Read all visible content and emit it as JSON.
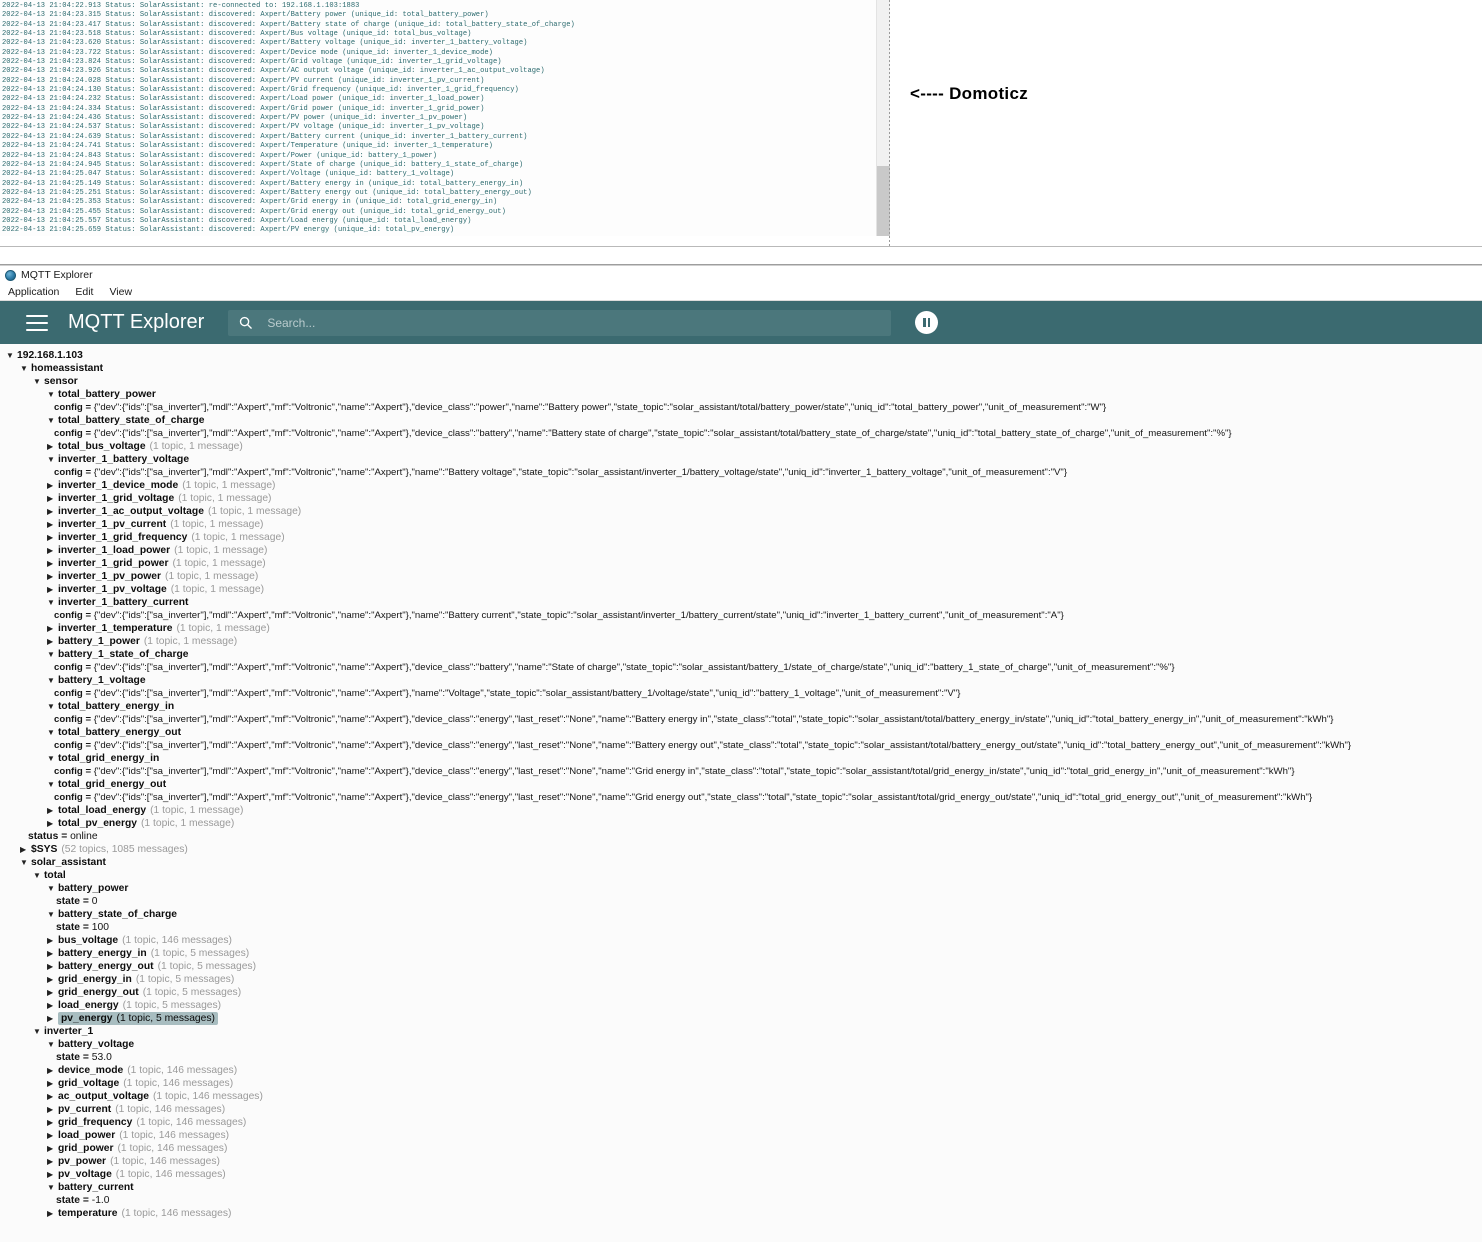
{
  "log_panel": {
    "lines": [
      "2022-04-13 21:04:22.913 Status: SolarAssistant: re-connected to: 192.168.1.103:1883",
      "2022-04-13 21:04:23.315 Status: SolarAssistant: discovered: Axpert/Battery power (unique_id: total_battery_power)",
      "2022-04-13 21:04:23.417 Status: SolarAssistant: discovered: Axpert/Battery state of charge (unique_id: total_battery_state_of_charge)",
      "2022-04-13 21:04:23.518 Status: SolarAssistant: discovered: Axpert/Bus voltage (unique_id: total_bus_voltage)",
      "2022-04-13 21:04:23.620 Status: SolarAssistant: discovered: Axpert/Battery voltage (unique_id: inverter_1_battery_voltage)",
      "2022-04-13 21:04:23.722 Status: SolarAssistant: discovered: Axpert/Device mode (unique_id: inverter_1_device_mode)",
      "2022-04-13 21:04:23.824 Status: SolarAssistant: discovered: Axpert/Grid voltage (unique_id: inverter_1_grid_voltage)",
      "2022-04-13 21:04:23.926 Status: SolarAssistant: discovered: Axpert/AC output voltage (unique_id: inverter_1_ac_output_voltage)",
      "2022-04-13 21:04:24.028 Status: SolarAssistant: discovered: Axpert/PV current (unique_id: inverter_1_pv_current)",
      "2022-04-13 21:04:24.130 Status: SolarAssistant: discovered: Axpert/Grid frequency (unique_id: inverter_1_grid_frequency)",
      "2022-04-13 21:04:24.232 Status: SolarAssistant: discovered: Axpert/Load power (unique_id: inverter_1_load_power)",
      "2022-04-13 21:04:24.334 Status: SolarAssistant: discovered: Axpert/Grid power (unique_id: inverter_1_grid_power)",
      "2022-04-13 21:04:24.436 Status: SolarAssistant: discovered: Axpert/PV power (unique_id: inverter_1_pv_power)",
      "2022-04-13 21:04:24.537 Status: SolarAssistant: discovered: Axpert/PV voltage (unique_id: inverter_1_pv_voltage)",
      "2022-04-13 21:04:24.639 Status: SolarAssistant: discovered: Axpert/Battery current (unique_id: inverter_1_battery_current)",
      "2022-04-13 21:04:24.741 Status: SolarAssistant: discovered: Axpert/Temperature (unique_id: inverter_1_temperature)",
      "2022-04-13 21:04:24.843 Status: SolarAssistant: discovered: Axpert/Power (unique_id: battery_1_power)",
      "2022-04-13 21:04:24.945 Status: SolarAssistant: discovered: Axpert/State of charge (unique_id: battery_1_state_of_charge)",
      "2022-04-13 21:04:25.047 Status: SolarAssistant: discovered: Axpert/Voltage (unique_id: battery_1_voltage)",
      "2022-04-13 21:04:25.149 Status: SolarAssistant: discovered: Axpert/Battery energy in (unique_id: total_battery_energy_in)",
      "2022-04-13 21:04:25.251 Status: SolarAssistant: discovered: Axpert/Battery energy out (unique_id: total_battery_energy_out)",
      "2022-04-13 21:04:25.353 Status: SolarAssistant: discovered: Axpert/Grid energy in (unique_id: total_grid_energy_in)",
      "2022-04-13 21:04:25.455 Status: SolarAssistant: discovered: Axpert/Grid energy out (unique_id: total_grid_energy_out)",
      "2022-04-13 21:04:25.557 Status: SolarAssistant: discovered: Axpert/Load energy (unique_id: total_load_energy)",
      "2022-04-13 21:04:25.659 Status: SolarAssistant: discovered: Axpert/PV energy (unique_id: total_pv_energy)"
    ]
  },
  "annotation": {
    "text": "<---- Domoticz"
  },
  "window": {
    "title": "MQTT Explorer",
    "menu": [
      "Application",
      "Edit",
      "View"
    ]
  },
  "app_bar": {
    "title": "MQTT Explorer",
    "search_placeholder": "Search...",
    "search_value": ""
  },
  "tree": {
    "nodes": [
      {
        "indent": 0,
        "arrow": "down",
        "label": "192.168.1.103"
      },
      {
        "indent": 1,
        "arrow": "down",
        "label": "homeassistant"
      },
      {
        "indent": 2,
        "arrow": "down",
        "label": "sensor"
      },
      {
        "indent": 3,
        "arrow": "down",
        "label": "total_battery_power"
      },
      {
        "type": "config",
        "indent": 4,
        "key": "config",
        "value": "{\"dev\":{\"ids\":[\"sa_inverter\"],\"mdl\":\"Axpert\",\"mf\":\"Voltronic\",\"name\":\"Axpert\"},\"device_class\":\"power\",\"name\":\"Battery power\",\"state_topic\":\"solar_assistant/total/battery_power/state\",\"uniq_id\":\"total_battery_power\",\"unit_of_measurement\":\"W\"}"
      },
      {
        "indent": 3,
        "arrow": "down",
        "label": "total_battery_state_of_charge"
      },
      {
        "type": "config",
        "indent": 4,
        "key": "config",
        "value": "{\"dev\":{\"ids\":[\"sa_inverter\"],\"mdl\":\"Axpert\",\"mf\":\"Voltronic\",\"name\":\"Axpert\"},\"device_class\":\"battery\",\"name\":\"Battery state of charge\",\"state_topic\":\"solar_assistant/total/battery_state_of_charge/state\",\"uniq_id\":\"total_battery_state_of_charge\",\"unit_of_measurement\":\"%\"}"
      },
      {
        "indent": 3,
        "arrow": "right",
        "label": "total_bus_voltage",
        "meta": "(1 topic, 1 message)"
      },
      {
        "indent": 3,
        "arrow": "down",
        "label": "inverter_1_battery_voltage"
      },
      {
        "type": "config",
        "indent": 4,
        "key": "config",
        "value": "{\"dev\":{\"ids\":[\"sa_inverter\"],\"mdl\":\"Axpert\",\"mf\":\"Voltronic\",\"name\":\"Axpert\"},\"name\":\"Battery voltage\",\"state_topic\":\"solar_assistant/inverter_1/battery_voltage/state\",\"uniq_id\":\"inverter_1_battery_voltage\",\"unit_of_measurement\":\"V\"}"
      },
      {
        "indent": 3,
        "arrow": "right",
        "label": "inverter_1_device_mode",
        "meta": "(1 topic, 1 message)"
      },
      {
        "indent": 3,
        "arrow": "right",
        "label": "inverter_1_grid_voltage",
        "meta": "(1 topic, 1 message)"
      },
      {
        "indent": 3,
        "arrow": "right",
        "label": "inverter_1_ac_output_voltage",
        "meta": "(1 topic, 1 message)"
      },
      {
        "indent": 3,
        "arrow": "right",
        "label": "inverter_1_pv_current",
        "meta": "(1 topic, 1 message)"
      },
      {
        "indent": 3,
        "arrow": "right",
        "label": "inverter_1_grid_frequency",
        "meta": "(1 topic, 1 message)"
      },
      {
        "indent": 3,
        "arrow": "right",
        "label": "inverter_1_load_power",
        "meta": "(1 topic, 1 message)"
      },
      {
        "indent": 3,
        "arrow": "right",
        "label": "inverter_1_grid_power",
        "meta": "(1 topic, 1 message)"
      },
      {
        "indent": 3,
        "arrow": "right",
        "label": "inverter_1_pv_power",
        "meta": "(1 topic, 1 message)"
      },
      {
        "indent": 3,
        "arrow": "right",
        "label": "inverter_1_pv_voltage",
        "meta": "(1 topic, 1 message)"
      },
      {
        "indent": 3,
        "arrow": "down",
        "label": "inverter_1_battery_current"
      },
      {
        "type": "config",
        "indent": 4,
        "key": "config",
        "value": "{\"dev\":{\"ids\":[\"sa_inverter\"],\"mdl\":\"Axpert\",\"mf\":\"Voltronic\",\"name\":\"Axpert\"},\"name\":\"Battery current\",\"state_topic\":\"solar_assistant/inverter_1/battery_current/state\",\"uniq_id\":\"inverter_1_battery_current\",\"unit_of_measurement\":\"A\"}"
      },
      {
        "indent": 3,
        "arrow": "right",
        "label": "inverter_1_temperature",
        "meta": "(1 topic, 1 message)"
      },
      {
        "indent": 3,
        "arrow": "right",
        "label": "battery_1_power",
        "meta": "(1 topic, 1 message)"
      },
      {
        "indent": 3,
        "arrow": "down",
        "label": "battery_1_state_of_charge"
      },
      {
        "type": "config",
        "indent": 4,
        "key": "config",
        "value": "{\"dev\":{\"ids\":[\"sa_inverter\"],\"mdl\":\"Axpert\",\"mf\":\"Voltronic\",\"name\":\"Axpert\"},\"device_class\":\"battery\",\"name\":\"State of charge\",\"state_topic\":\"solar_assistant/battery_1/state_of_charge/state\",\"uniq_id\":\"battery_1_state_of_charge\",\"unit_of_measurement\":\"%\"}"
      },
      {
        "indent": 3,
        "arrow": "down",
        "label": "battery_1_voltage"
      },
      {
        "type": "config",
        "indent": 4,
        "key": "config",
        "value": "{\"dev\":{\"ids\":[\"sa_inverter\"],\"mdl\":\"Axpert\",\"mf\":\"Voltronic\",\"name\":\"Axpert\"},\"name\":\"Voltage\",\"state_topic\":\"solar_assistant/battery_1/voltage/state\",\"uniq_id\":\"battery_1_voltage\",\"unit_of_measurement\":\"V\"}"
      },
      {
        "indent": 3,
        "arrow": "down",
        "label": "total_battery_energy_in"
      },
      {
        "type": "config",
        "indent": 4,
        "key": "config",
        "value": "{\"dev\":{\"ids\":[\"sa_inverter\"],\"mdl\":\"Axpert\",\"mf\":\"Voltronic\",\"name\":\"Axpert\"},\"device_class\":\"energy\",\"last_reset\":\"None\",\"name\":\"Battery energy in\",\"state_class\":\"total\",\"state_topic\":\"solar_assistant/total/battery_energy_in/state\",\"uniq_id\":\"total_battery_energy_in\",\"unit_of_measurement\":\"kWh\"}"
      },
      {
        "indent": 3,
        "arrow": "down",
        "label": "total_battery_energy_out"
      },
      {
        "type": "config",
        "indent": 4,
        "key": "config",
        "value": "{\"dev\":{\"ids\":[\"sa_inverter\"],\"mdl\":\"Axpert\",\"mf\":\"Voltronic\",\"name\":\"Axpert\"},\"device_class\":\"energy\",\"last_reset\":\"None\",\"name\":\"Battery energy out\",\"state_class\":\"total\",\"state_topic\":\"solar_assistant/total/battery_energy_out/state\",\"uniq_id\":\"total_battery_energy_out\",\"unit_of_measurement\":\"kWh\"}"
      },
      {
        "indent": 3,
        "arrow": "down",
        "label": "total_grid_energy_in"
      },
      {
        "type": "config",
        "indent": 4,
        "key": "config",
        "value": "{\"dev\":{\"ids\":[\"sa_inverter\"],\"mdl\":\"Axpert\",\"mf\":\"Voltronic\",\"name\":\"Axpert\"},\"device_class\":\"energy\",\"last_reset\":\"None\",\"name\":\"Grid energy in\",\"state_class\":\"total\",\"state_topic\":\"solar_assistant/total/grid_energy_in/state\",\"uniq_id\":\"total_grid_energy_in\",\"unit_of_measurement\":\"kWh\"}"
      },
      {
        "indent": 3,
        "arrow": "down",
        "label": "total_grid_energy_out"
      },
      {
        "type": "config",
        "indent": 4,
        "key": "config",
        "value": "{\"dev\":{\"ids\":[\"sa_inverter\"],\"mdl\":\"Axpert\",\"mf\":\"Voltronic\",\"name\":\"Axpert\"},\"device_class\":\"energy\",\"last_reset\":\"None\",\"name\":\"Grid energy out\",\"state_class\":\"total\",\"state_topic\":\"solar_assistant/total/grid_energy_out/state\",\"uniq_id\":\"total_grid_energy_out\",\"unit_of_measurement\":\"kWh\"}"
      },
      {
        "indent": 3,
        "arrow": "right",
        "label": "total_load_energy",
        "meta": "(1 topic, 1 message)"
      },
      {
        "indent": 3,
        "arrow": "right",
        "label": "total_pv_energy",
        "meta": "(1 topic, 1 message)"
      },
      {
        "type": "kv",
        "indent": 2,
        "key": "status",
        "value": "online"
      },
      {
        "indent": 1,
        "arrow": "right",
        "label": "$SYS",
        "meta": "(52 topics, 1085 messages)"
      },
      {
        "indent": 1,
        "arrow": "down",
        "label": "solar_assistant"
      },
      {
        "indent": 2,
        "arrow": "down",
        "label": "total"
      },
      {
        "indent": 3,
        "arrow": "down",
        "label": "battery_power"
      },
      {
        "type": "kv",
        "indent": 4,
        "key": "state",
        "value": "0"
      },
      {
        "indent": 3,
        "arrow": "down",
        "label": "battery_state_of_charge"
      },
      {
        "type": "kv",
        "indent": 4,
        "key": "state",
        "value": "100"
      },
      {
        "indent": 3,
        "arrow": "right",
        "label": "bus_voltage",
        "meta": "(1 topic, 146 messages)"
      },
      {
        "indent": 3,
        "arrow": "right",
        "label": "battery_energy_in",
        "meta": "(1 topic, 5 messages)"
      },
      {
        "indent": 3,
        "arrow": "right",
        "label": "battery_energy_out",
        "meta": "(1 topic, 5 messages)"
      },
      {
        "indent": 3,
        "arrow": "right",
        "label": "grid_energy_in",
        "meta": "(1 topic, 5 messages)"
      },
      {
        "indent": 3,
        "arrow": "right",
        "label": "grid_energy_out",
        "meta": "(1 topic, 5 messages)"
      },
      {
        "indent": 3,
        "arrow": "right",
        "label": "load_energy",
        "meta": "(1 topic, 5 messages)"
      },
      {
        "indent": 3,
        "arrow": "right",
        "label": "pv_energy",
        "meta": "(1 topic, 5 messages)",
        "selected": true
      },
      {
        "indent": 2,
        "arrow": "down",
        "label": "inverter_1"
      },
      {
        "indent": 3,
        "arrow": "down",
        "label": "battery_voltage"
      },
      {
        "type": "kv",
        "indent": 4,
        "key": "state",
        "value": "53.0"
      },
      {
        "indent": 3,
        "arrow": "right",
        "label": "device_mode",
        "meta": "(1 topic, 146 messages)"
      },
      {
        "indent": 3,
        "arrow": "right",
        "label": "grid_voltage",
        "meta": "(1 topic, 146 messages)"
      },
      {
        "indent": 3,
        "arrow": "right",
        "label": "ac_output_voltage",
        "meta": "(1 topic, 146 messages)"
      },
      {
        "indent": 3,
        "arrow": "right",
        "label": "pv_current",
        "meta": "(1 topic, 146 messages)"
      },
      {
        "indent": 3,
        "arrow": "right",
        "label": "grid_frequency",
        "meta": "(1 topic, 146 messages)"
      },
      {
        "indent": 3,
        "arrow": "right",
        "label": "load_power",
        "meta": "(1 topic, 146 messages)"
      },
      {
        "indent": 3,
        "arrow": "right",
        "label": "grid_power",
        "meta": "(1 topic, 146 messages)"
      },
      {
        "indent": 3,
        "arrow": "right",
        "label": "pv_power",
        "meta": "(1 topic, 146 messages)"
      },
      {
        "indent": 3,
        "arrow": "right",
        "label": "pv_voltage",
        "meta": "(1 topic, 146 messages)"
      },
      {
        "indent": 3,
        "arrow": "down",
        "label": "battery_current"
      },
      {
        "type": "kv",
        "indent": 4,
        "key": "state",
        "value": "-1.0"
      },
      {
        "indent": 3,
        "arrow": "right",
        "label": "temperature",
        "meta": "(1 topic, 146 messages)"
      }
    ]
  },
  "colors": {
    "app_bar": "#3b6a70",
    "search_field": "#4b777c",
    "log_text": "#2b6a6e",
    "selection": "#a8bdc0"
  }
}
